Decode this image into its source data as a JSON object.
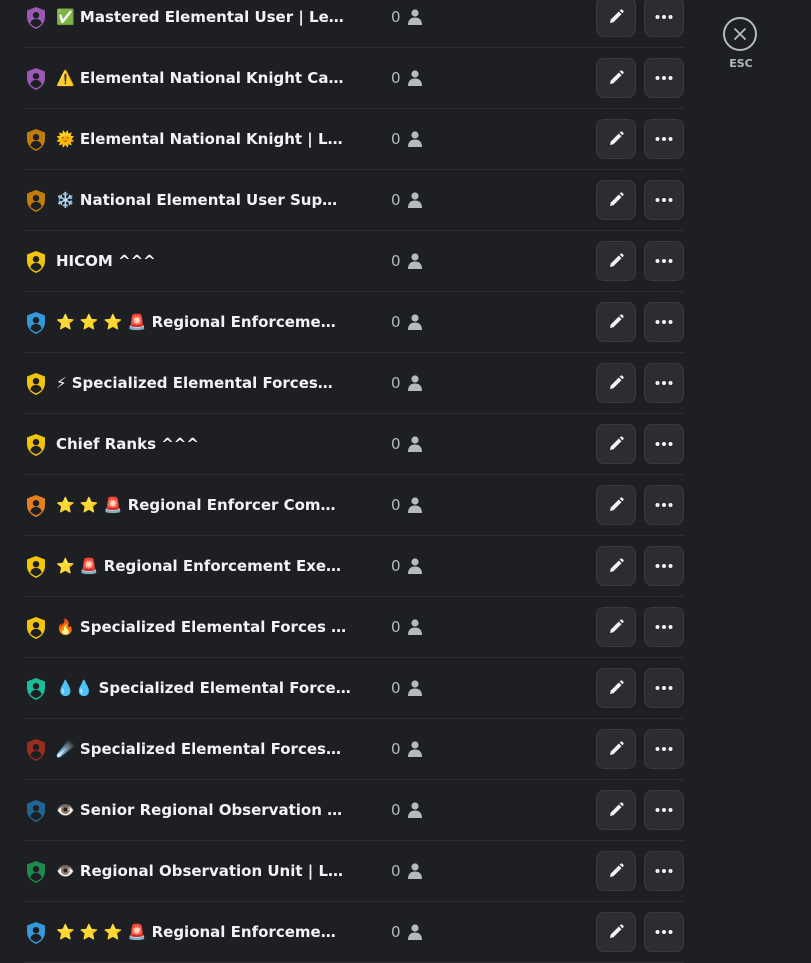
{
  "close": {
    "label": "ESC"
  },
  "roles": [
    {
      "name": "✅ Mastered Elemental User | Le…",
      "members": "0",
      "color": "#9b59b6"
    },
    {
      "name": "⚠️ Elemental National Knight Ca…",
      "members": "0",
      "color": "#9b59b6"
    },
    {
      "name": "🌞 Elemental National Knight | L…",
      "members": "0",
      "color": "#c27c0e"
    },
    {
      "name": "❄️ National Elemental User Sup…",
      "members": "0",
      "color": "#c27c0e"
    },
    {
      "name": "HICOM ^^^",
      "members": "0",
      "color": "#f1c40f"
    },
    {
      "name": "⭐ ⭐ ⭐ 🚨 Regional Enforceme…",
      "members": "0",
      "color": "#3498db"
    },
    {
      "name": "⚡ Specialized Elemental Forces…",
      "members": "0",
      "color": "#f1c40f"
    },
    {
      "name": "Chief Ranks ^^^",
      "members": "0",
      "color": "#f1c40f"
    },
    {
      "name": "⭐ ⭐ 🚨 Regional Enforcer Com…",
      "members": "0",
      "color": "#e67e22"
    },
    {
      "name": "⭐ 🚨 Regional Enforcement Exe…",
      "members": "0",
      "color": "#f1c40f"
    },
    {
      "name": "🔥 Specialized Elemental Forces …",
      "members": "0",
      "color": "#f1c40f"
    },
    {
      "name": "💧💧 Specialized Elemental Force…",
      "members": "0",
      "color": "#1abc9c"
    },
    {
      "name": "☄️ Specialized Elemental Forces…",
      "members": "0",
      "color": "#992d22"
    },
    {
      "name": "👁️ Senior Regional Observation …",
      "members": "0",
      "color": "#206694"
    },
    {
      "name": "👁️ Regional Observation Unit | L…",
      "members": "0",
      "color": "#1f8b4c"
    },
    {
      "name": "⭐ ⭐ ⭐ 🚨 Regional Enforceme…",
      "members": "0",
      "color": "#3498db"
    }
  ]
}
